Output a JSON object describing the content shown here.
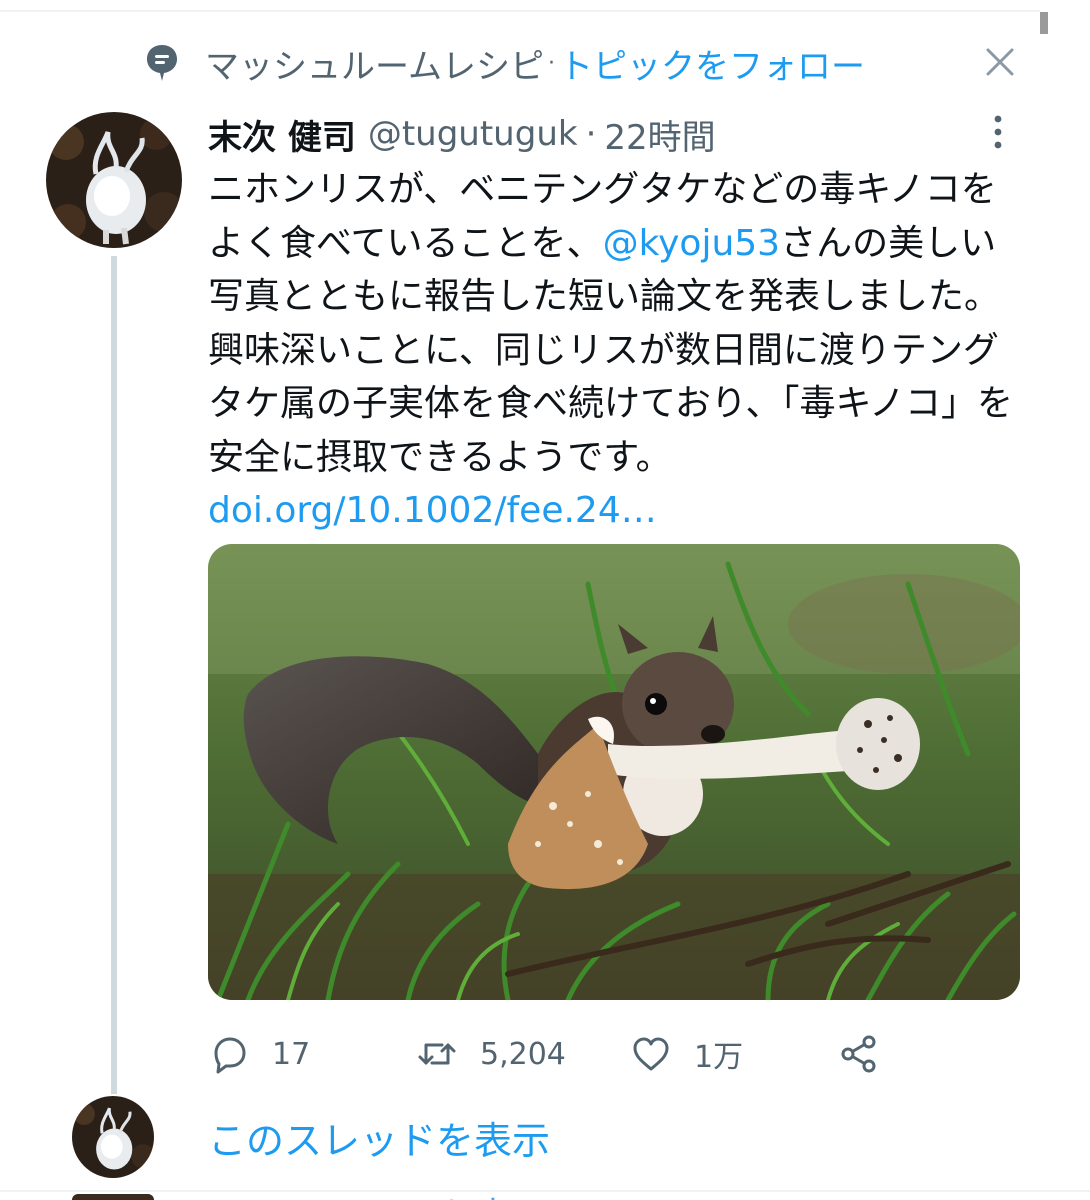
{
  "topic": {
    "icon": "topic-bubble-icon",
    "name": "マッシュルームレシピ",
    "separator": "·",
    "follow_label": "トピックをフォロー",
    "close_icon": "close-icon"
  },
  "tweet": {
    "display_name": "末次 健司",
    "handle": "@tugutuguk",
    "separator": "·",
    "time": "22時間",
    "more_icon": "more-vertical-icon",
    "text_1": "ニホンリスが、ベニテングタケなどの毒キノコをよく食べていることを、",
    "mention": "@kyoju53",
    "text_2": "さんの美しい写真とともに報告した短い論文を発表しました。興味深いことに、同じリスが数日間に渡りテングタケ属の子実体を食べ続けており、「毒キノコ」を安全に摂取できるようです。",
    "link": "doi.org/10.1002/fee.24…",
    "media": "squirrel-eating-mushroom-photo"
  },
  "actions": {
    "reply_count": "17",
    "retweet_count": "5,204",
    "like_count": "1万",
    "reply_icon": "reply-icon",
    "retweet_icon": "retweet-icon",
    "like_icon": "heart-icon",
    "share_icon": "share-icon"
  },
  "thread": {
    "show_label": "このスレッドを表示"
  },
  "colors": {
    "accent": "#1d9bf0",
    "secondary_text": "#536471",
    "primary_text": "#0f1419",
    "thread_line": "#cfd9de"
  }
}
